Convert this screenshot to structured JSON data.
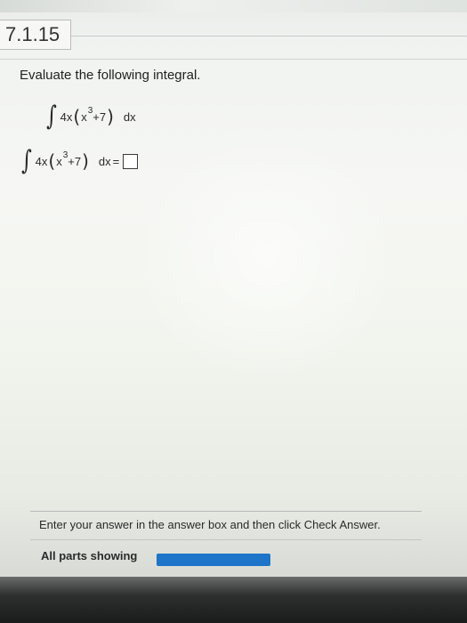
{
  "header": {
    "problem_number": "7.1.15"
  },
  "question": {
    "instruction": "Evaluate the following integral.",
    "integrand_coefficient": "4x",
    "inner_base": "x",
    "inner_exponent": "3",
    "inner_rest": "+7",
    "differential": "dx",
    "equals": "="
  },
  "footer": {
    "instruction": "Enter your answer in the answer box and then click Check Answer.",
    "parts_label": "All parts showing",
    "progress_fraction": 1.0,
    "progress_color": "#1d74c8"
  },
  "icons": {
    "integral": "integral-sign"
  }
}
